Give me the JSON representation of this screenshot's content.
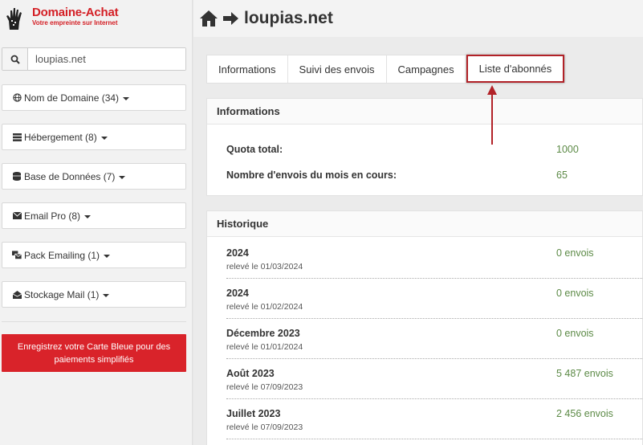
{
  "logo": {
    "title": "Domaine-Achat",
    "subtitle": "Votre empreinte sur Internet"
  },
  "search": {
    "value": "loupias.net"
  },
  "sidebar": {
    "items": [
      {
        "label": "Nom de Domaine (34)",
        "icon": "globe-icon"
      },
      {
        "label": "Hébergement (8)",
        "icon": "server-icon"
      },
      {
        "label": "Base de Données (7)",
        "icon": "database-icon"
      },
      {
        "label": "Email Pro (8)",
        "icon": "envelope-icon"
      },
      {
        "label": "Pack Emailing (1)",
        "icon": "mailing-icon"
      },
      {
        "label": "Stockage Mail (1)",
        "icon": "inbox-icon"
      }
    ],
    "card_button": "Enregistrez votre Carte Bleue pour des paiements simplifiés"
  },
  "header": {
    "title": "loupias.net"
  },
  "tabs": [
    {
      "label": "Informations"
    },
    {
      "label": "Suivi des envois"
    },
    {
      "label": "Campagnes"
    },
    {
      "label": "Liste d'abonnés",
      "active": true
    }
  ],
  "informations": {
    "title": "Informations",
    "rows": [
      {
        "label": "Quota total:",
        "value": "1000"
      },
      {
        "label": "Nombre d'envois du mois en cours:",
        "value": "65"
      }
    ]
  },
  "historique": {
    "title": "Historique",
    "rows": [
      {
        "period": "2024",
        "date": "relevé le 01/03/2024",
        "value": "0 envois"
      },
      {
        "period": "2024",
        "date": "relevé le 01/02/2024",
        "value": "0 envois"
      },
      {
        "period": "Décembre 2023",
        "date": "relevé le 01/01/2024",
        "value": "0 envois"
      },
      {
        "period": "Août 2023",
        "date": "relevé le 07/09/2023",
        "value": "5 487 envois"
      },
      {
        "period": "Juillet 2023",
        "date": "relevé le 07/09/2023",
        "value": "2 456 envois"
      }
    ]
  },
  "colors": {
    "brand_red": "#d42026",
    "value_green": "#5c8a46",
    "highlight_red": "#b22228"
  }
}
